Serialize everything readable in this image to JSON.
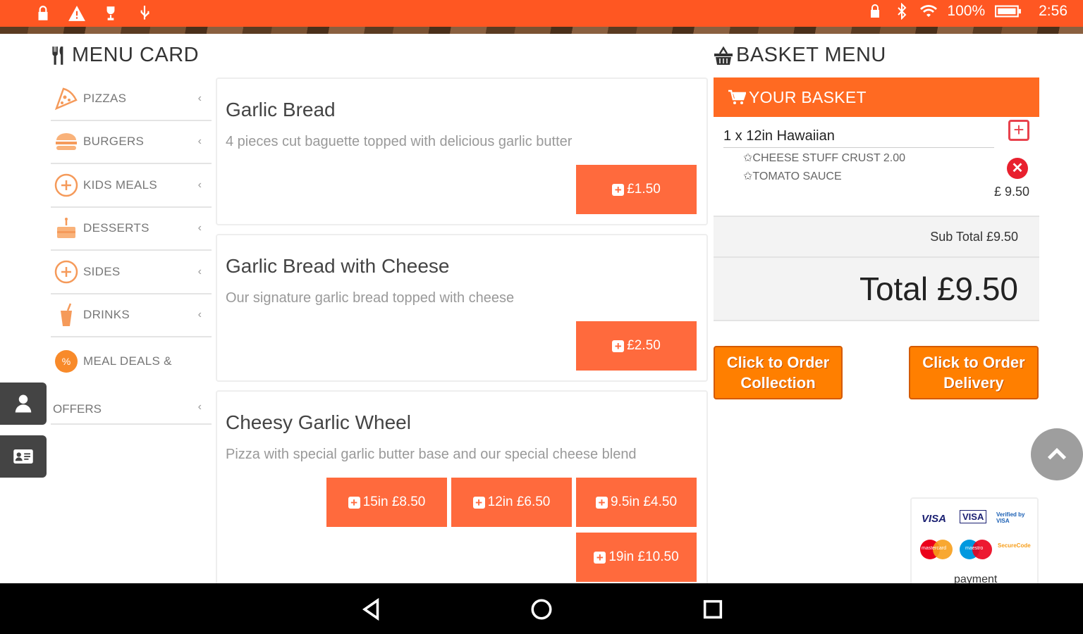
{
  "status_bar": {
    "left_icons": [
      "lock-icon",
      "warning-icon",
      "trophy-icon",
      "usb-icon"
    ],
    "right_icons": [
      "lock-icon",
      "bluetooth-icon",
      "wifi-icon"
    ],
    "battery": "100%",
    "time": "2:56",
    "color": "#ff5722"
  },
  "menu_card": {
    "title": "MENU CARD",
    "icon": "fork-knife-icon",
    "categories": [
      {
        "label": "PIZZAS",
        "icon": "pizza-icon"
      },
      {
        "label": "BURGERS",
        "icon": "burger-icon"
      },
      {
        "label": "KIDS MEALS",
        "icon": "plus-circle-icon"
      },
      {
        "label": "DESSERTS",
        "icon": "cake-icon"
      },
      {
        "label": "SIDES",
        "icon": "plus-circle-icon"
      },
      {
        "label": "DRINKS",
        "icon": "drink-icon"
      },
      {
        "label": "MEAL DEALS &",
        "label2": "OFFERS",
        "icon": "offer-icon"
      }
    ],
    "chevron": "‹"
  },
  "items": [
    {
      "title": "Garlic Bread",
      "desc": "4 pieces cut baguette topped with delicious garlic butter",
      "prices": [
        "£1.50"
      ]
    },
    {
      "title": "Garlic Bread with Cheese",
      "desc": "Our signature garlic bread topped with cheese",
      "prices": [
        "£2.50"
      ]
    },
    {
      "title": "Cheesy Garlic Wheel",
      "desc": "Pizza with special garlic butter base and our special cheese blend",
      "prices": [
        "15in £8.50",
        "12in £6.50",
        "9.5in £4.50",
        "19in £10.50"
      ]
    }
  ],
  "basket": {
    "title": "BASKET MENU",
    "header": "YOUR BASKET",
    "item_name": "1 x 12in Hawaiian",
    "options": [
      "✩CHEESE STUFF CRUST 2.00",
      "✩TOMATO SAUCE"
    ],
    "item_price": "£ 9.50",
    "subtotal": "Sub Total £9.50",
    "total": "Total £9.50",
    "btn_collection": [
      "Click to Order",
      "Collection"
    ],
    "btn_delivery": [
      "Click to Order",
      "Delivery"
    ]
  },
  "payment": {
    "row1": [
      "VISA",
      "VISA",
      "Verified by VISA"
    ],
    "row2": [
      "mastercard",
      "maestro",
      "SecureCode"
    ],
    "footer": "payment"
  },
  "accent": "#ff6a3d"
}
